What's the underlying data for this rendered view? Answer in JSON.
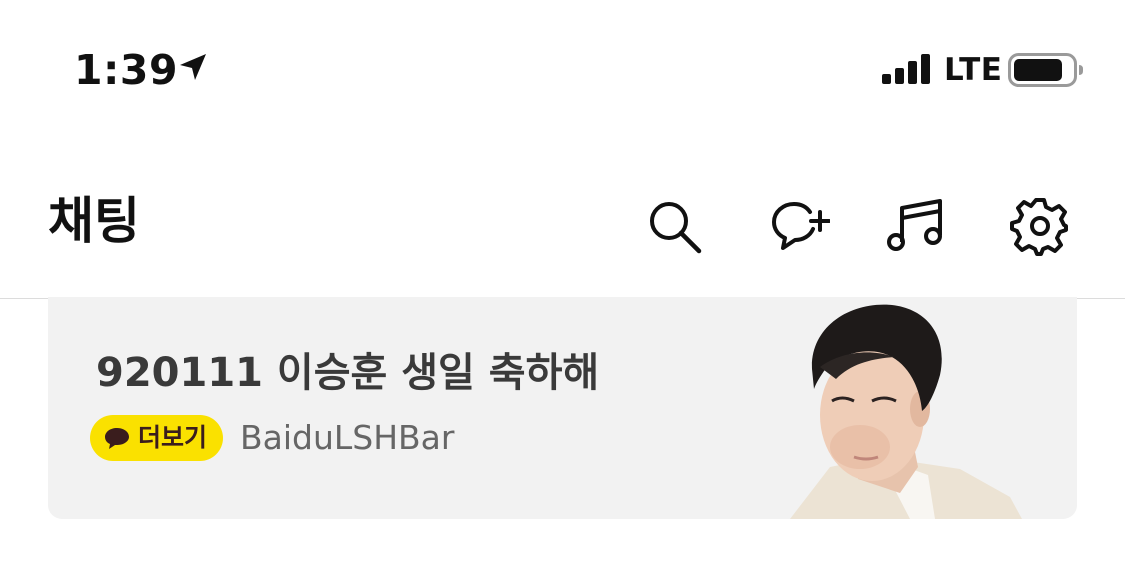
{
  "status_bar": {
    "time": "1:39",
    "signal_label": "LTE",
    "icons": [
      "location-arrow-icon",
      "signal-bars-icon",
      "battery-icon"
    ]
  },
  "header": {
    "title": "채팅",
    "actions": [
      {
        "name": "search-button",
        "icon": "search-icon"
      },
      {
        "name": "new-chat-button",
        "icon": "chat-plus-icon"
      },
      {
        "name": "music-button",
        "icon": "music-note-icon"
      },
      {
        "name": "settings-button",
        "icon": "gear-icon"
      }
    ]
  },
  "banner": {
    "title": "920111 이승훈 생일 축하해",
    "more_label": "더보기",
    "source": "BaiduLSHBar",
    "image": "portrait-photo",
    "colors": {
      "background": "#f2f2f2",
      "badge": "#fae100"
    }
  }
}
